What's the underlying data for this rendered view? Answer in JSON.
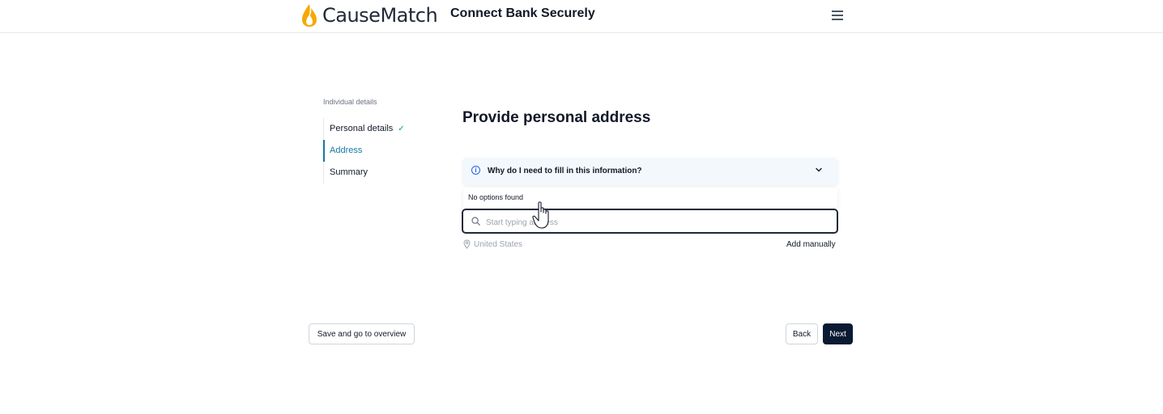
{
  "header": {
    "logo_text": "CauseMatch",
    "title": "Connect Bank Securely",
    "menu_icon": "hamburger-menu-icon"
  },
  "sidebar": {
    "heading": "Individual details",
    "steps": [
      {
        "label": "Personal details",
        "completed": true
      },
      {
        "label": "Address",
        "active": true
      },
      {
        "label": "Summary"
      }
    ]
  },
  "main": {
    "title": "Provide personal address",
    "accordion": {
      "label": "Why do I need to fill in this information?",
      "expanded": false
    },
    "dropdown_message": "No options found",
    "search": {
      "placeholder": "Start typing address",
      "value": ""
    },
    "country": "United States",
    "add_manually": "Add manually"
  },
  "footer": {
    "save_label": "Save and go to overview",
    "back_label": "Back",
    "next_label": "Next"
  },
  "colors": {
    "accent": "#1677a8",
    "primary_button": "#0b1a33",
    "check": "#0f9d8a",
    "logo_flame": "#f5a800"
  }
}
